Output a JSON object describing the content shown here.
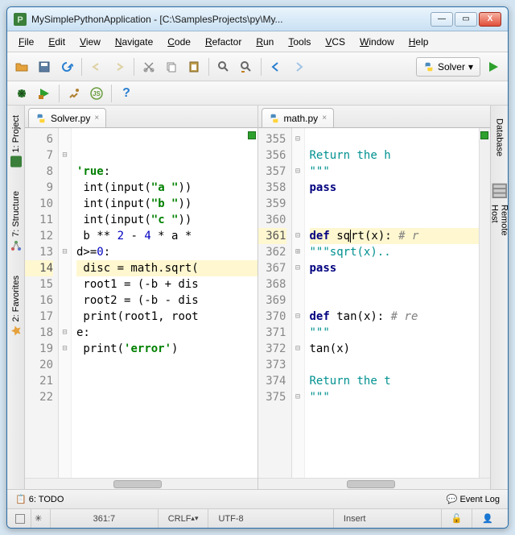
{
  "window": {
    "title": "MySimplePythonApplication - [C:\\SamplesProjects\\py\\My..."
  },
  "menu": [
    "File",
    "Edit",
    "View",
    "Navigate",
    "Code",
    "Refactor",
    "Run",
    "Tools",
    "VCS",
    "Window",
    "Help"
  ],
  "run_config": "Solver",
  "left_tabs": {
    "project": "1: Project",
    "structure": "7: Structure",
    "favorites": "2: Favorites"
  },
  "right_tabs": {
    "database": "Database",
    "remote": "Remote Host"
  },
  "left_editor": {
    "filename": "Solver.py",
    "start": 6,
    "highlight": 14,
    "lines": [
      "",
      "",
      "'rue:",
      " int(input(\"a \"))",
      " int(input(\"b \"))",
      " int(input(\"c \"))",
      " b ** 2 - 4 * a *",
      "d>=0:",
      " disc = math.sqrt(",
      " root1 = (-b + dis",
      " root2 = (-b - dis",
      " print(root1, root",
      "e:",
      " print('error')",
      "",
      "",
      ""
    ]
  },
  "right_editor": {
    "filename": "math.py",
    "lnums": [
      "355",
      "356",
      "357",
      "358",
      "359",
      "360",
      "361",
      "362",
      "367",
      "368",
      "369",
      "370",
      "371",
      "372",
      "373",
      "374",
      "375"
    ],
    "lines_html": [
      "",
      "<span class='doc'>Return the h</span>",
      "<span class='doc'>\"\"\"</span>",
      "<span class='kw'>pass</span>",
      "",
      "",
      "<span class='kw'>def</span> sq<span style='border-left:1px solid #000'>r</span>t(x): <span class='cm'># r</span>",
      "<span class='doc'>\"\"\"sqrt(x)..</span>",
      "<span class='kw'>pass</span>",
      "",
      "",
      "<span class='kw'>def</span> tan(x): <span class='cm'># re</span>",
      "<span class='doc'>\"\"\"</span>",
      "tan(x)",
      "",
      "<span class='doc'>Return the t</span>",
      "<span class='doc'>\"\"\"</span>"
    ]
  },
  "bottom": {
    "todo": "6: TODO",
    "eventlog": "Event Log"
  },
  "status": {
    "pos": "361:7",
    "sep": "CRLF",
    "enc": "UTF-8",
    "ins": "Insert"
  }
}
